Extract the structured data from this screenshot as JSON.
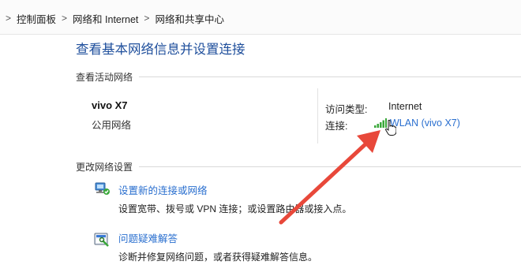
{
  "breadcrumb": {
    "separator": ">",
    "items": [
      "控制面板",
      "网络和 Internet",
      "网络和共享中心"
    ]
  },
  "page": {
    "title": "查看基本网络信息并设置连接"
  },
  "active_networks": {
    "heading": "查看活动网络",
    "network_name": "vivo X7",
    "network_category": "公用网络",
    "access_type_label": "访问类型:",
    "access_type_value": "Internet",
    "connection_label": "连接:",
    "connection_value": "WLAN (vivo X7)"
  },
  "change_settings": {
    "heading": "更改网络设置",
    "items": [
      {
        "link": "设置新的连接或网络",
        "description": "设置宽带、拨号或 VPN 连接；或设置路由器或接入点。",
        "icon": "network-setup-icon"
      },
      {
        "link": "问题疑难解答",
        "description": "诊断并修复网络问题，或者获得疑难解答信息。",
        "icon": "troubleshoot-icon"
      }
    ]
  },
  "colors": {
    "link": "#2a6fcf",
    "title": "#1f4f9c",
    "annotation_arrow": "#e8483a",
    "signal": "#3aa83a"
  }
}
